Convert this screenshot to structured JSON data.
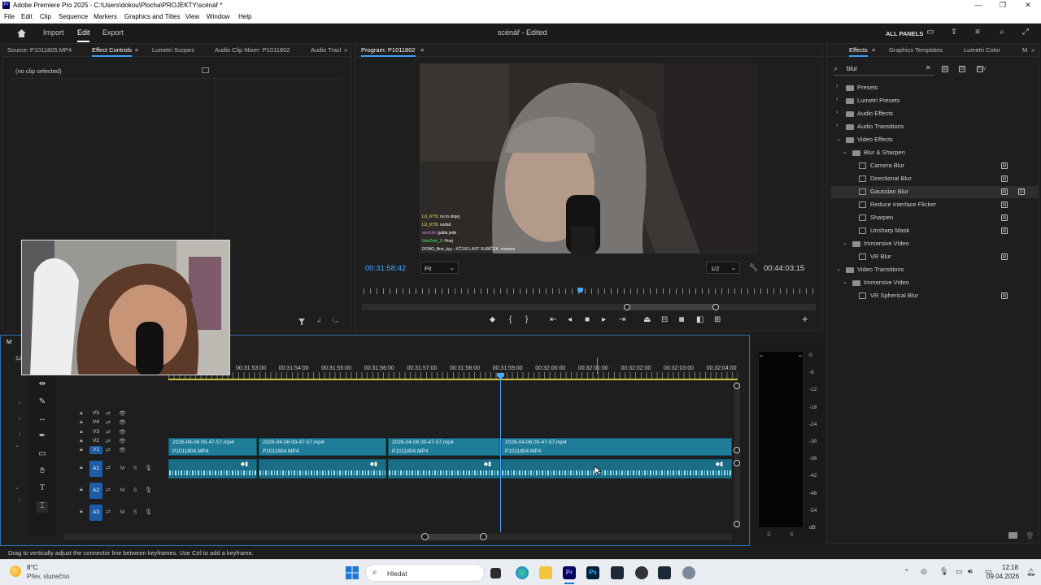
{
  "window": {
    "title": "Adobe Premiere Pro 2025 - C:\\Users\\dokou\\Plocha\\PROJEKTY\\scénář *",
    "minimize": "—",
    "maximize": "❐",
    "close": "✕"
  },
  "menu": [
    "File",
    "Edit",
    "Clip",
    "Sequence",
    "Markers",
    "Graphics and Titles",
    "View",
    "Window",
    "Help"
  ],
  "header": {
    "nav": [
      "Import",
      "Edit",
      "Export"
    ],
    "active_nav": "Edit",
    "project_title": "scénář - Edited",
    "all_panels": "ALL PANELS"
  },
  "left_panel": {
    "tabs": [
      "Source: P1011805.MP4",
      "Effect Controls",
      "Lumetri Scopes",
      "Audio Clip Mixer: P1011802",
      "Audio Tracl"
    ],
    "active_tab": "Effect Controls",
    "no_clip": "(no clip selected)"
  },
  "program": {
    "tab": "Program: P1011802",
    "timecode_left": "00:31:58:42",
    "fit": "Fit",
    "resolution": "1/2",
    "timecode_right": "00:44:03:15",
    "chat": [
      {
        "user": "LU_KYS",
        "msg": ": no to stojej"
      },
      {
        "user": "LU_KYS",
        "msg": ": sodsd"
      },
      {
        "user": "anickiki",
        "msg": ": gabla jede"
      },
      {
        "user": "HonZoto_0",
        "msg": ": Hoej"
      },
      {
        "user": "DONO",
        "msg": "_Bne_kyy - KČ150  LAST SUBÍČEK: mnsace"
      }
    ]
  },
  "timeline": {
    "tab": "M",
    "tab2": "Lo",
    "ruler": [
      "00:31:53:00",
      "00:31:54:00",
      "00:31:55:00",
      "00:31:56:00",
      "00:31:57:00",
      "00:31:58:00",
      "00:31:59:00",
      "00:32:00:00",
      "00:32:01:00",
      "00:32:02:00",
      "00:32:03:00",
      "00:32:04:00"
    ],
    "video_tracks": [
      "V5",
      "V4",
      "V3",
      "V2",
      "V1"
    ],
    "audio_tracks": [
      "A1",
      "A2",
      "A3"
    ],
    "clip_top": "2026-04-06 00-47-57.mp4",
    "clip_bottom": "P1011804.MP4",
    "mute": "M",
    "solo": "S"
  },
  "effects": {
    "tabs": [
      "Effects",
      "Graphics Templates",
      "Lumetri Color",
      "M"
    ],
    "active_tab": "Effects",
    "search": "blur",
    "tree": [
      {
        "label": "Presets",
        "level": 0,
        "type": "folder",
        "expanded": false
      },
      {
        "label": "Lumetri Presets",
        "level": 0,
        "type": "folder",
        "expanded": false
      },
      {
        "label": "Audio Effects",
        "level": 0,
        "type": "folder",
        "expanded": false
      },
      {
        "label": "Audio Transitions",
        "level": 0,
        "type": "folder",
        "expanded": false
      },
      {
        "label": "Video Effects",
        "level": 0,
        "type": "folder",
        "expanded": true
      },
      {
        "label": "Blur & Sharpen",
        "level": 1,
        "type": "folder",
        "expanded": true
      },
      {
        "label": "Camera Blur",
        "level": 2,
        "type": "effect"
      },
      {
        "label": "Directional Blur",
        "level": 2,
        "type": "effect"
      },
      {
        "label": "Gaussian Blur",
        "level": 2,
        "type": "effect",
        "selected": true
      },
      {
        "label": "Reduce Interlace Flicker",
        "level": 2,
        "type": "effect"
      },
      {
        "label": "Sharpen",
        "level": 2,
        "type": "effect"
      },
      {
        "label": "Unsharp Mask",
        "level": 2,
        "type": "effect"
      },
      {
        "label": "Immersive Video",
        "level": 1,
        "type": "folder",
        "expanded": true
      },
      {
        "label": "VR Blur",
        "level": 2,
        "type": "effect"
      },
      {
        "label": "Video Transitions",
        "level": 0,
        "type": "folder",
        "expanded": true
      },
      {
        "label": "Immersive Video",
        "level": 1,
        "type": "folder",
        "expanded": true
      },
      {
        "label": "VR Spherical Blur",
        "level": 2,
        "type": "transition"
      }
    ]
  },
  "meter": {
    "scale": [
      "0",
      "-6",
      "-12",
      "-18",
      "-24",
      "-30",
      "-36",
      "-42",
      "-48",
      "-54",
      "dB"
    ],
    "solo": "S"
  },
  "status": "Drag to vertically adjust the connector line between keyframes. Use Ctrl to add a keyframe.",
  "taskbar": {
    "temp": "8°C",
    "weather": "Přev. slunečno",
    "search": "Hledat",
    "time": "12:18",
    "date": "09.04.2026"
  }
}
